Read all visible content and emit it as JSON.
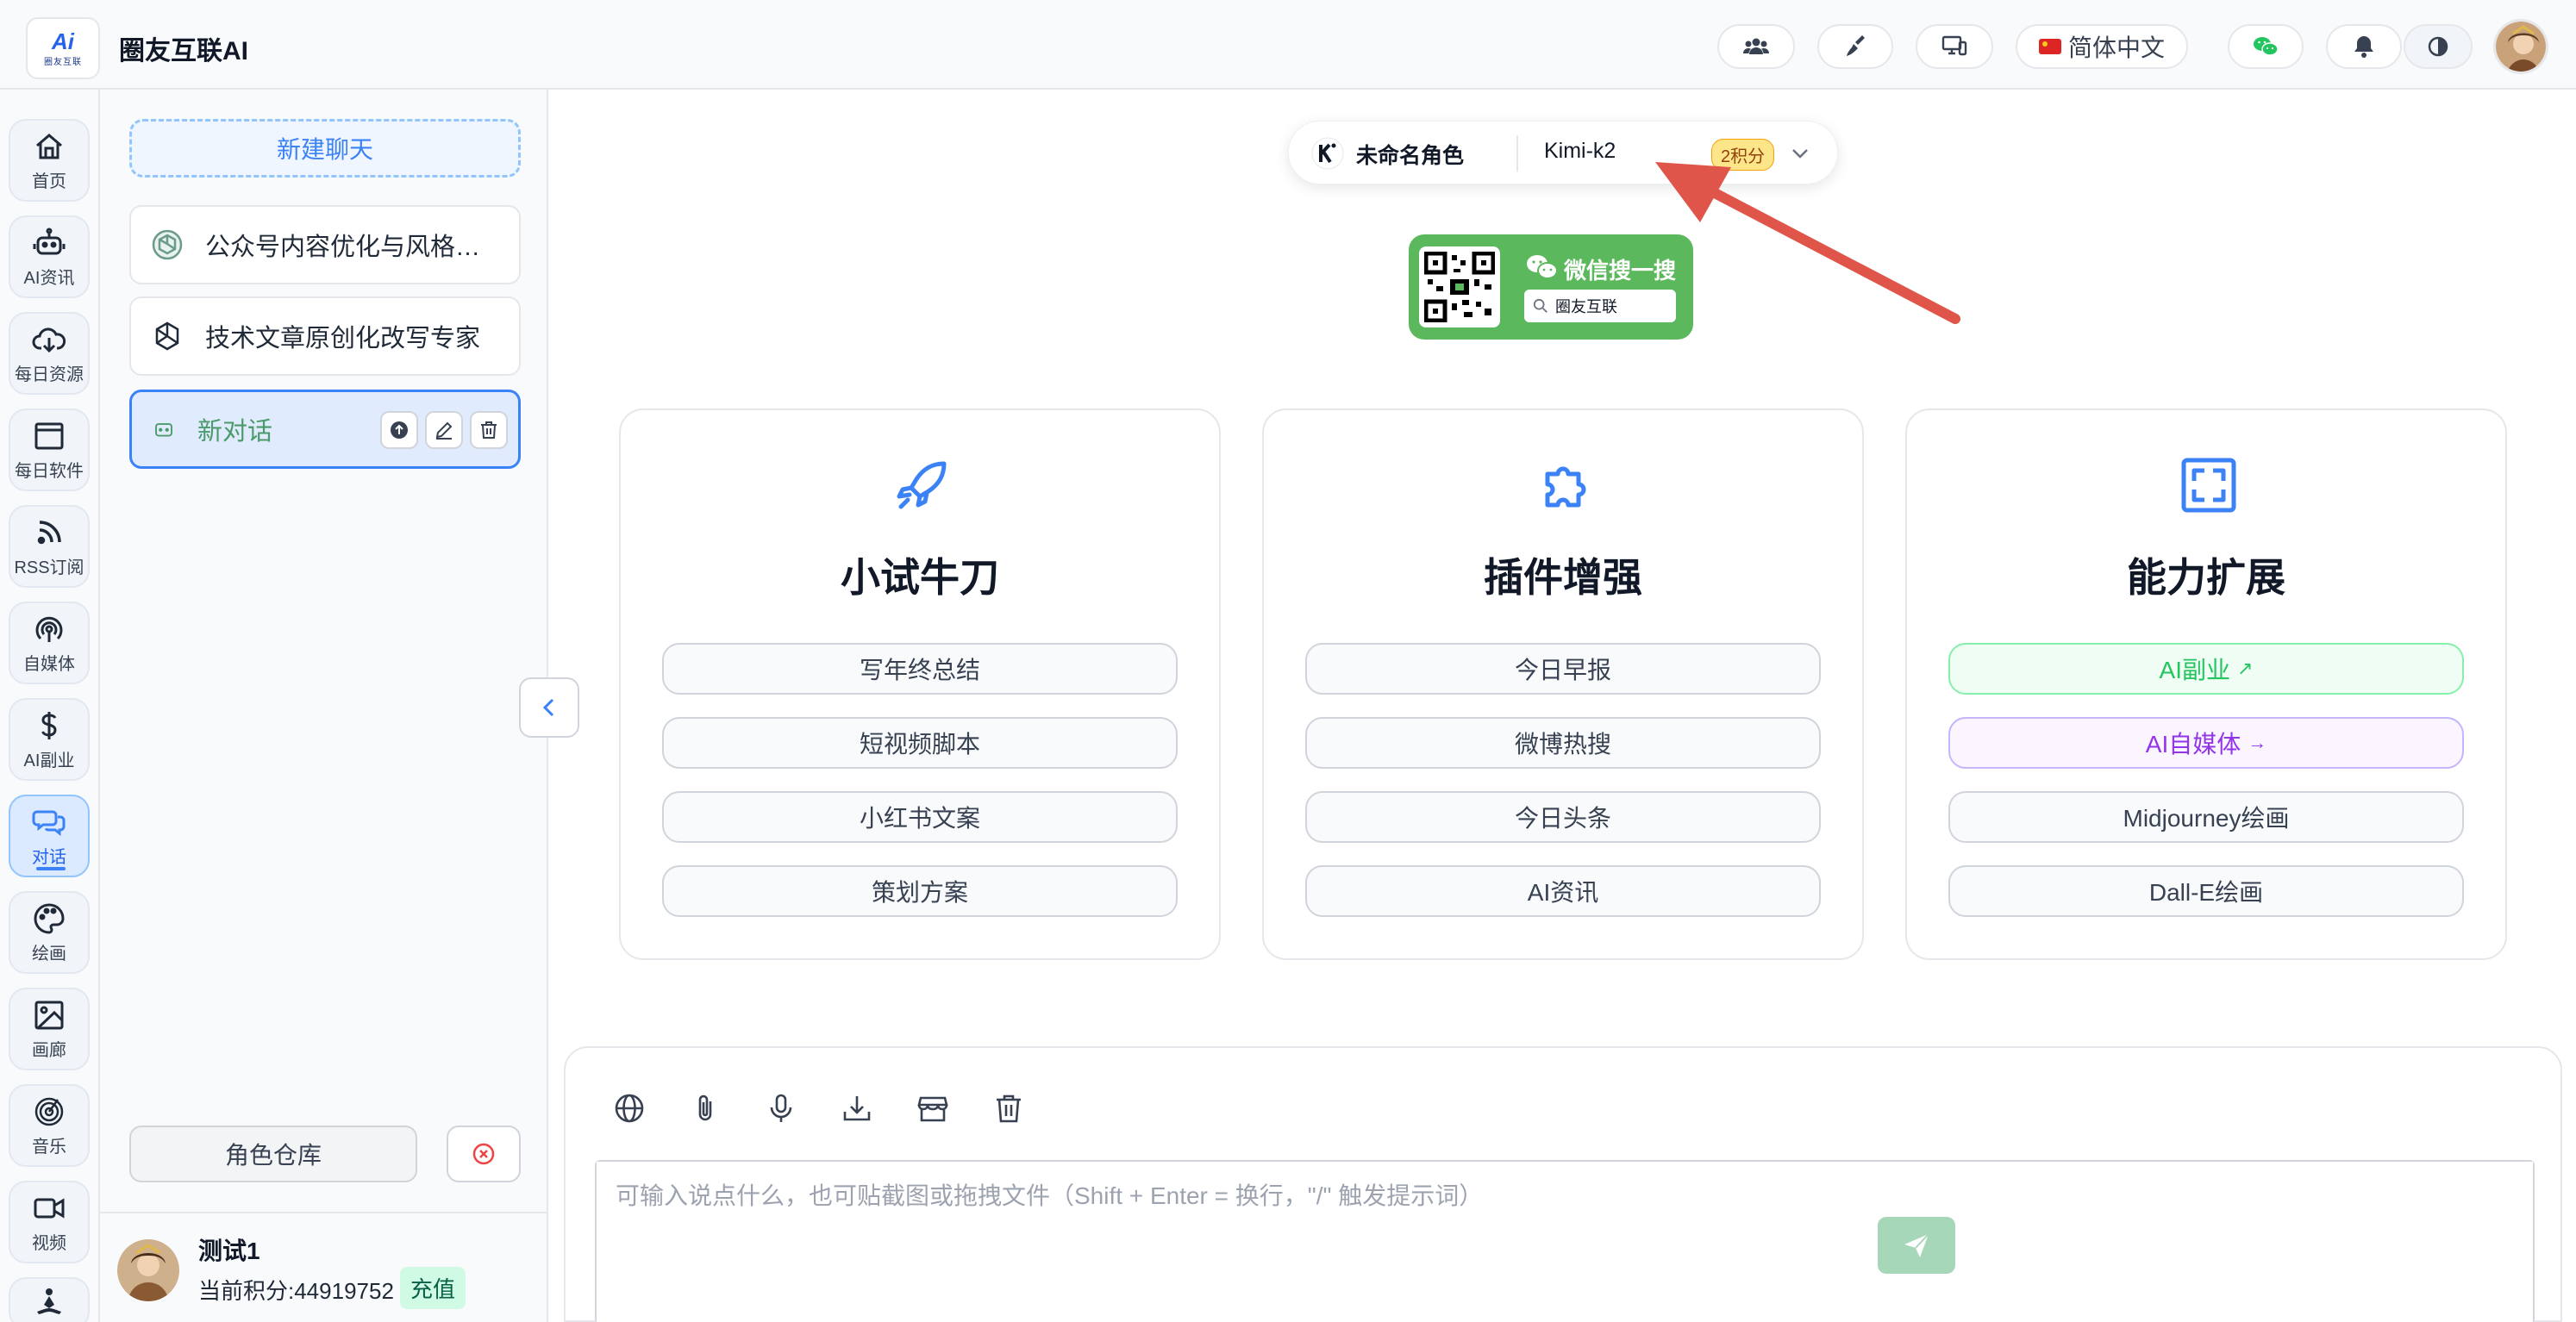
{
  "app": {
    "title": "圈友互联AI",
    "logo_text": "Ai",
    "logo_sub": "圈友互联"
  },
  "topbar": {
    "language": "简体中文",
    "icons": [
      "community-icon",
      "broom-icon",
      "devices-icon",
      "wechat-icon",
      "bell-icon",
      "theme-icon"
    ]
  },
  "rail": {
    "items": [
      {
        "label": "首页",
        "icon": "home-icon"
      },
      {
        "label": "AI资讯",
        "icon": "robot-icon"
      },
      {
        "label": "每日资源",
        "icon": "cloud-download-icon"
      },
      {
        "label": "每日软件",
        "icon": "window-icon"
      },
      {
        "label": "RSS订阅",
        "icon": "rss-icon"
      },
      {
        "label": "自媒体",
        "icon": "broadcast-icon"
      },
      {
        "label": "AI副业",
        "icon": "dollar-icon"
      },
      {
        "label": "对话",
        "icon": "chat-icon"
      },
      {
        "label": "绘画",
        "icon": "palette-icon"
      },
      {
        "label": "画廊",
        "icon": "image-icon"
      },
      {
        "label": "音乐",
        "icon": "music-icon"
      },
      {
        "label": "视频",
        "icon": "video-icon"
      },
      {
        "label": "",
        "icon": "meditate-icon"
      }
    ],
    "active": "对话"
  },
  "conversations": {
    "new_chat": "新建聊天",
    "items": [
      {
        "title": "公众号内容优化与风格适...",
        "icon": "openai-icon"
      },
      {
        "title": "技术文章原创化改写专家",
        "icon": "openai-icon"
      },
      {
        "title": "新对话",
        "icon": "bot-icon"
      }
    ],
    "role_library": "角色仓库"
  },
  "user": {
    "name": "测试1",
    "points_label": "当前积分:44919752",
    "recharge": "充值"
  },
  "model_selector": {
    "role": "未命名角色",
    "model": "Kimi-k2",
    "cost": "2积分"
  },
  "wechat_banner": {
    "title": "微信搜一搜",
    "search_text": "圈友互联"
  },
  "cards": [
    {
      "title": "小试牛刀",
      "icon": "rocket-icon",
      "options": [
        {
          "label": "写年终总结"
        },
        {
          "label": "短视频脚本"
        },
        {
          "label": "小红书文案"
        },
        {
          "label": "策划方案"
        }
      ]
    },
    {
      "title": "插件增强",
      "icon": "puzzle-icon",
      "options": [
        {
          "label": "今日早报"
        },
        {
          "label": "微博热搜"
        },
        {
          "label": "今日头条"
        },
        {
          "label": "AI资讯"
        }
      ]
    },
    {
      "title": "能力扩展",
      "icon": "expand-icon",
      "options": [
        {
          "label": "AI副业",
          "suffix": "↗",
          "style": "green"
        },
        {
          "label": "AI自媒体",
          "suffix": "→",
          "style": "purple"
        },
        {
          "label": "Midjourney绘画"
        },
        {
          "label": "Dall-E绘画"
        }
      ]
    }
  ],
  "input": {
    "placeholder": "可输入说点什么，也可贴截图或拖拽文件（Shift + Enter = 换行，\"/\" 触发提示词）",
    "value": ""
  },
  "colors": {
    "accent": "#3b82f6",
    "send_button": "#a7d7b9",
    "arrow": "#e0554a"
  }
}
